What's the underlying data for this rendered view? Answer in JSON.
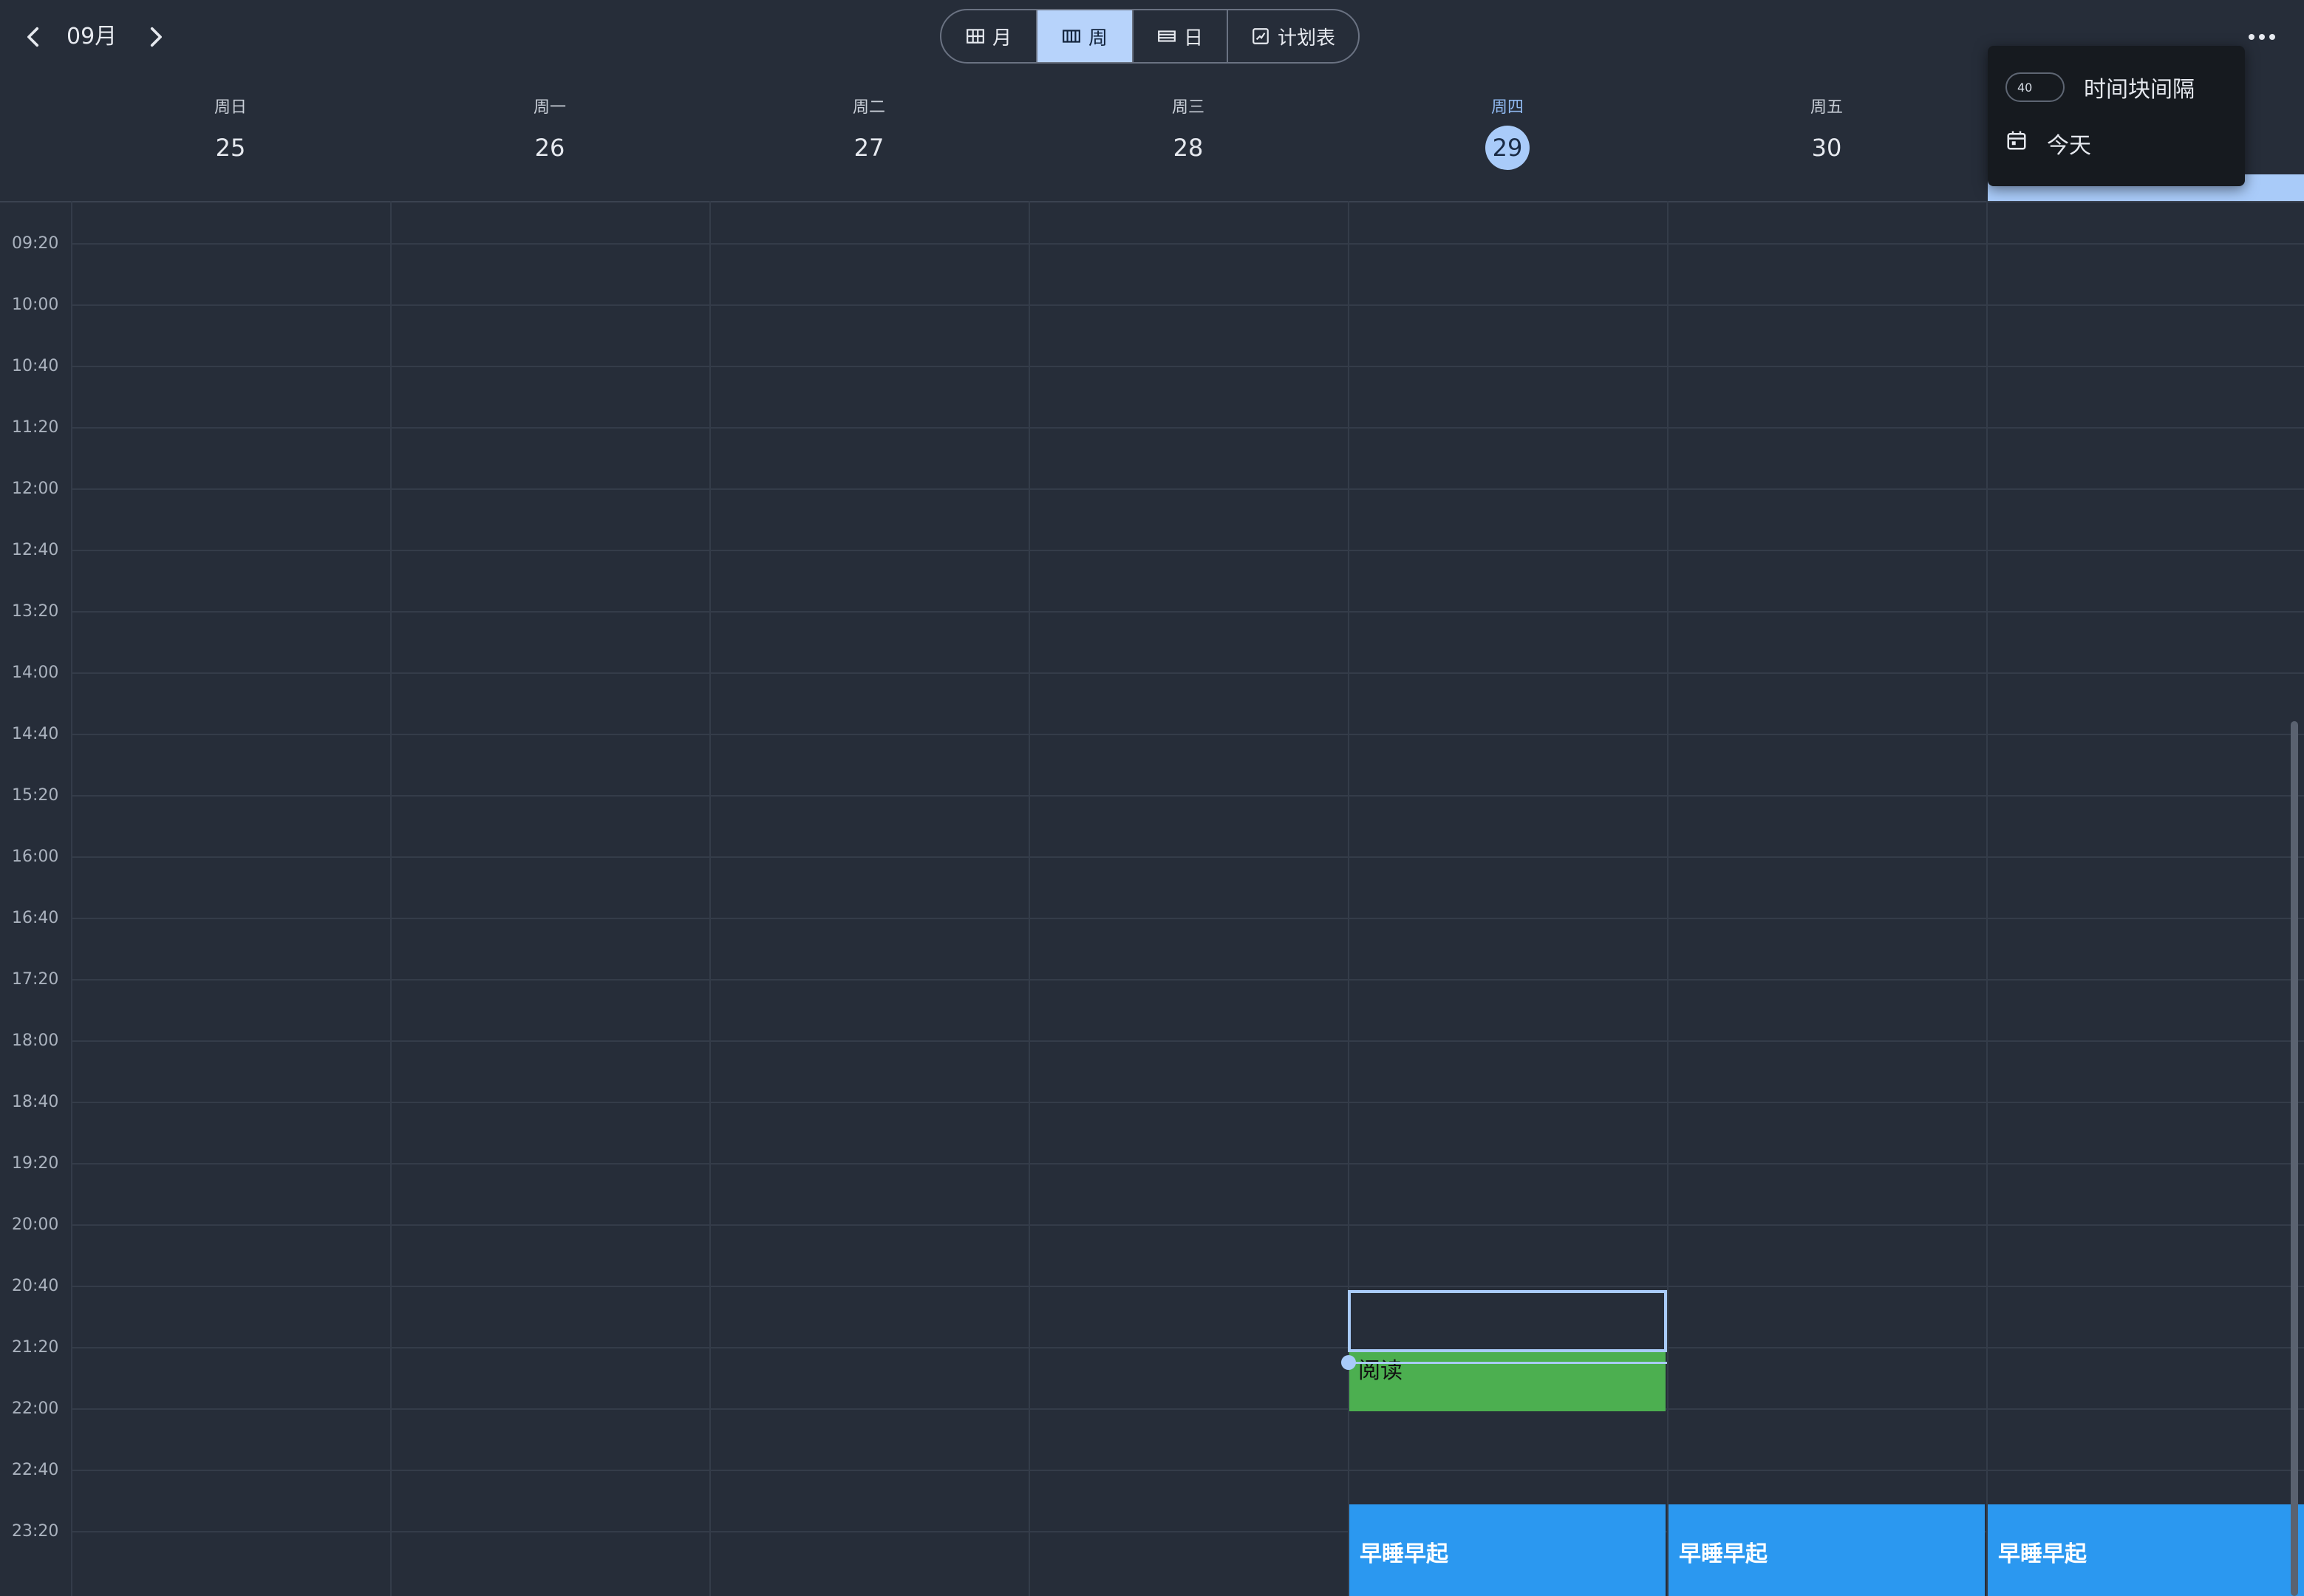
{
  "header": {
    "month": "09月",
    "prev_icon": "chevron-left-icon",
    "next_icon": "chevron-right-icon",
    "views": [
      {
        "label": "月",
        "icon": "grid-icon",
        "active": false
      },
      {
        "label": "周",
        "icon": "week-columns-icon",
        "active": true
      },
      {
        "label": "日",
        "icon": "day-rows-icon",
        "active": false
      },
      {
        "label": "计划表",
        "icon": "schedule-icon",
        "active": false
      }
    ],
    "more_icon": "more-horizontal-icon"
  },
  "days": [
    {
      "weekday": "周日",
      "date": "25",
      "today": false
    },
    {
      "weekday": "周一",
      "date": "26",
      "today": false
    },
    {
      "weekday": "周二",
      "date": "27",
      "today": false
    },
    {
      "weekday": "周三",
      "date": "28",
      "today": false
    },
    {
      "weekday": "周四",
      "date": "29",
      "today": true
    },
    {
      "weekday": "周五",
      "date": "30",
      "today": false
    }
  ],
  "times": [
    "09:20",
    "10:00",
    "10:40",
    "11:20",
    "12:00",
    "12:40",
    "13:20",
    "14:00",
    "14:40",
    "15:20",
    "16:00",
    "16:40",
    "17:20",
    "18:00",
    "18:40",
    "19:20",
    "20:00",
    "20:40",
    "21:20",
    "22:00",
    "22:40",
    "23:20"
  ],
  "events": {
    "reading": {
      "title": "阅读",
      "color": "#4caf50"
    },
    "sleep": {
      "title": "早睡早起",
      "color": "#2b98f0"
    }
  },
  "popup": {
    "interval_value": "40",
    "interval_label": "时间块间隔",
    "today_label": "今天",
    "today_icon": "calendar-icon"
  },
  "colors": {
    "background": "#262d39",
    "accent": "#a9cbf9",
    "grid": "#343c49"
  }
}
